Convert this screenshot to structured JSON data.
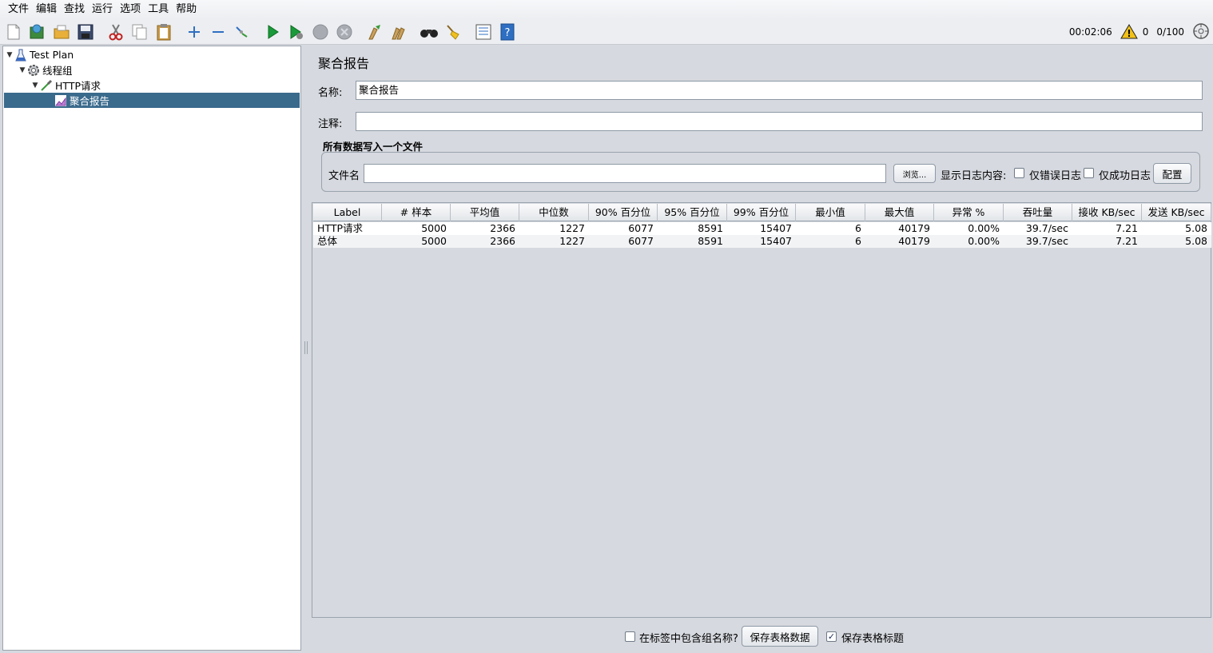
{
  "menu": [
    "文件",
    "编辑",
    "查找",
    "运行",
    "选项",
    "工具",
    "帮助"
  ],
  "status": {
    "elapsed": "00:02:06",
    "warnings": "0",
    "threads": "0/100"
  },
  "tree": [
    {
      "label": "Test Plan",
      "icon": "test-plan-icon",
      "depth": 0,
      "expanded": true
    },
    {
      "label": "线程组",
      "icon": "thread-group-gear-icon",
      "depth": 1,
      "expanded": true
    },
    {
      "label": "HTTP请求",
      "icon": "http-sampler-pipette-icon",
      "depth": 2,
      "expanded": true
    },
    {
      "label": "聚合报告",
      "icon": "report-chart-icon",
      "depth": 3,
      "selected": true
    }
  ],
  "panel": {
    "title": "聚合报告",
    "name_label": "名称:",
    "name_value": "聚合报告",
    "comment_label": "注释:",
    "comment_value": "",
    "file_group_title": "所有数据写入一个文件",
    "filename_label": "文件名",
    "filename_value": "",
    "browse_button": "浏览...",
    "log_label": "显示日志内容:",
    "errors_only": "仅错误日志",
    "success_only": "仅成功日志",
    "configure_button": "配置"
  },
  "table": {
    "headers": [
      "Label",
      "# 样本",
      "平均值",
      "中位数",
      "90% 百分位",
      "95% 百分位",
      "99% 百分位",
      "最小值",
      "最大值",
      "异常 %",
      "吞吐量",
      "接收 KB/sec",
      "发送 KB/sec"
    ],
    "rows": [
      [
        "HTTP请求",
        "5000",
        "2366",
        "1227",
        "6077",
        "8591",
        "15407",
        "6",
        "40179",
        "0.00%",
        "39.7/sec",
        "7.21",
        "5.08"
      ],
      [
        "总体",
        "5000",
        "2366",
        "1227",
        "6077",
        "8591",
        "15407",
        "6",
        "40179",
        "0.00%",
        "39.7/sec",
        "7.21",
        "5.08"
      ]
    ]
  },
  "bottom": {
    "include_group_label": "在标签中包含组名称?",
    "include_group_checked": false,
    "save_data_button": "保存表格数据",
    "save_header_label": "保存表格标题",
    "save_header_checked": true
  }
}
